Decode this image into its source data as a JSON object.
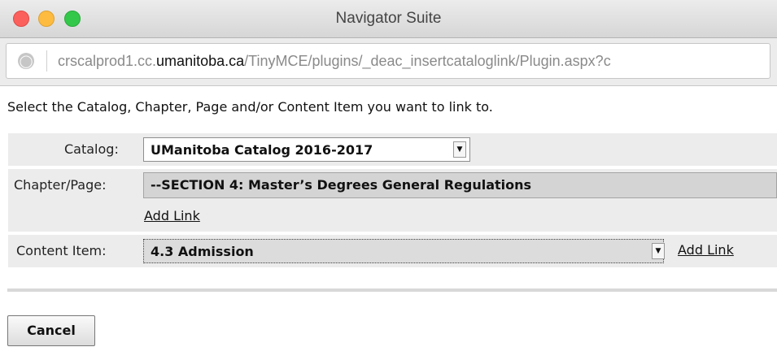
{
  "window": {
    "title": "Navigator Suite"
  },
  "address_bar": {
    "url_prefix": "crscalprod1.cc.",
    "url_domain": "umanitoba.ca",
    "url_path": "/TinyMCE/plugins/_deac_insertcataloglink/Plugin.aspx?c",
    "icon": "globe-icon"
  },
  "form": {
    "instruction": "Select the Catalog, Chapter, Page and/or Content Item you want to link to.",
    "catalog": {
      "label": "Catalog:",
      "value": "UManitoba Catalog 2016-2017"
    },
    "chapter_page": {
      "label": "Chapter/Page:",
      "value": "--SECTION 4: Master’s Degrees General Regulations",
      "add_link": "Add Link"
    },
    "content_item": {
      "label": "Content Item:",
      "value": "4.3 Admission",
      "add_link": "Add Link"
    }
  },
  "actions": {
    "cancel": "Cancel"
  },
  "colors": {
    "row_background": "#ececec",
    "close_light": "#fc605c",
    "minimize_light": "#fdbc40",
    "zoom_light": "#34c84a"
  }
}
